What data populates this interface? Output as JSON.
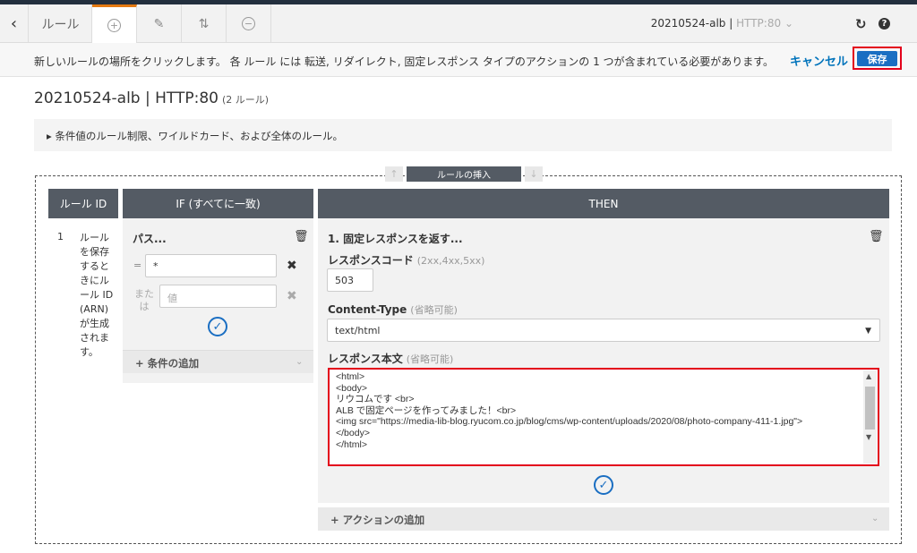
{
  "toolbar": {
    "tab_rules": "ルール",
    "lb_name": "20210524-alb",
    "lb_sep": " | ",
    "lb_listener": "HTTP:80",
    "lb_chevron": "⌵"
  },
  "infobar": {
    "message": "新しいルールの場所をクリックします。 各 ルール には 転送, リダイレクト, 固定レスポンス タイプのアクションの 1 つが含まれている必要があります。",
    "cancel_label": "キャンセル",
    "save_label": "保存"
  },
  "page": {
    "title": "20210524-alb | HTTP:80",
    "rule_count": "(2 ルール)",
    "note": "条件値のルール制限、ワイルドカード、および全体のルール。"
  },
  "rules_editor": {
    "insert_label": "ルールの挿入",
    "col_rule_id": "ルール ID",
    "col_if": "IF (すべてに一致)",
    "col_then": "THEN",
    "rule_number": "1",
    "rule_id_note": "ルールを保存するときにルール ID (ARN) が生成されます。"
  },
  "condition": {
    "title": "パス...",
    "operator": "=",
    "path_value": "*",
    "or_label": "または",
    "value_placeholder": "値",
    "add_condition_label": "条件の追加"
  },
  "action": {
    "title": "1. 固定レスポンスを返す...",
    "response_code_label": "レスポンスコード",
    "response_code_hint": "(2xx,4xx,5xx)",
    "response_code_value": "503",
    "content_type_label": "Content-Type",
    "content_type_hint": "(省略可能)",
    "content_type_value": "text/html",
    "body_label": "レスポンス本文",
    "body_hint": "(省略可能)",
    "body_value": "<html>\n<body>\nリウコムです <br>\nALB で固定ページを作ってみました！<br>\n<img src=\"https://media-lib-blog.ryucom.co.jp/blog/cms/wp-content/uploads/2020/08/photo-company-411-1.jpg\">\n</body>\n</html>",
    "add_action_label": "アクションの追加"
  },
  "colors": {
    "accent_blue": "#1a6ec2",
    "link_blue": "#0073bb",
    "header_gray": "#545b64",
    "highlight_red": "#e3001b",
    "tab_orange": "#e47911"
  }
}
